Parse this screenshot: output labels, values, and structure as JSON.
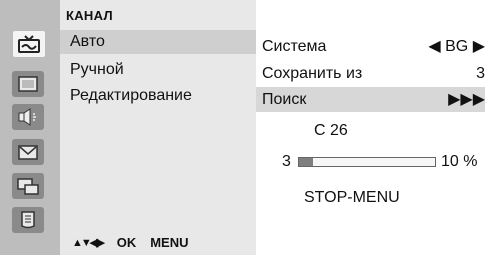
{
  "left_panel": {
    "title": "КАНАЛ",
    "items": [
      {
        "label": "Авто",
        "selected": true
      },
      {
        "label": "Ручной",
        "selected": false
      },
      {
        "label": "Редактирование",
        "selected": false
      }
    ],
    "hints": {
      "nav": "▲▼◀▶",
      "ok": "OK",
      "menu": "MENU"
    }
  },
  "rail_icons": [
    {
      "name": "channel-tv-icon",
      "active": true
    },
    {
      "name": "picture-icon",
      "active": false
    },
    {
      "name": "sound-icon",
      "active": false
    },
    {
      "name": "time-icon",
      "active": false
    },
    {
      "name": "special-icon",
      "active": false
    },
    {
      "name": "screen-icon",
      "active": false
    }
  ],
  "right_panel": {
    "rows": [
      {
        "label": "Система",
        "value": "◀ BG ▶",
        "selected": false
      },
      {
        "label": "Сохранить из",
        "value": "3",
        "selected": false
      },
      {
        "label": "Поиск",
        "value": "▶▶▶",
        "selected": true
      }
    ],
    "channel": "C 26",
    "progress": {
      "left_value": "3",
      "percent_label": "10 %",
      "fraction": 0.1
    },
    "stop_text": "STOP-MENU"
  },
  "colors": {
    "rail": "#bdbdbd",
    "rail_icon_bg": "#8a8a8a",
    "panel": "#e8e8e8",
    "highlight": "#cfcfcf",
    "progress_fill": "#7f7f7f"
  }
}
